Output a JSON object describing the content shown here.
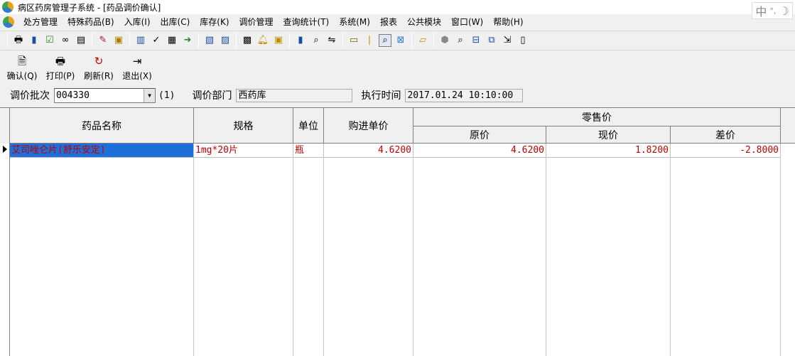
{
  "window": {
    "title": "病区药房管理子系统 - [药品调价确认]",
    "ime_text": "中",
    "ime_extra": "°,"
  },
  "menu": [
    "处方管理",
    "特殊药品(B)",
    "入库(I)",
    "出库(C)",
    "库存(K)",
    "调价管理",
    "查询统计(T)",
    "系统(M)",
    "报表",
    "公共模块",
    "窗口(W)",
    "帮助(H)"
  ],
  "toolbar_icons": [
    "printer-preview-icon",
    "bottle-icon",
    "check-box-icon",
    "binoculars-icon",
    "card-icon",
    "document-edit-icon",
    "id-card-icon",
    "notepad-icon",
    "checkmark-icon",
    "form-icon",
    "export-icon",
    "table-edit-icon",
    "table-view-icon",
    "grid-icon",
    "bell-icon",
    "calendar-icon",
    "trash-icon",
    "search-pair-icon",
    "compare-icon",
    "folder-icon",
    "thermometer-icon",
    "magnifier-icon",
    "close-box-icon",
    "open-folder-icon",
    "cube-icon",
    "zoom-icon",
    "window-tile-icon",
    "cascade-icon",
    "arrow-doc-icon",
    "paste-icon"
  ],
  "actions": [
    {
      "label": "确认(Q)",
      "icon": "confirm-doc-icon"
    },
    {
      "label": "打印(P)",
      "icon": "printer-icon"
    },
    {
      "label": "刷新(R)",
      "icon": "refresh-icon"
    },
    {
      "label": "退出(X)",
      "icon": "exit-door-icon"
    }
  ],
  "filters": {
    "batch_label": "调价批次",
    "batch_value": "004330",
    "batch_count": "(1)",
    "dept_label": "调价部门",
    "dept_value": "西药库",
    "exec_label": "执行时间",
    "exec_value": "2017.01.24 10:10:00"
  },
  "grid": {
    "headers": {
      "name": "药品名称",
      "spec": "规格",
      "unit": "单位",
      "purchase": "购进单价",
      "retail": "零售价",
      "original": "原价",
      "current": "现价",
      "diff": "差价"
    },
    "rows": [
      {
        "name": "艾司唑仑片(舒乐安定)",
        "spec": "1mg*20片",
        "unit": "瓶",
        "purchase": "4.6200",
        "original": "4.6200",
        "current": "1.8200",
        "diff": "-2.8000"
      }
    ]
  }
}
